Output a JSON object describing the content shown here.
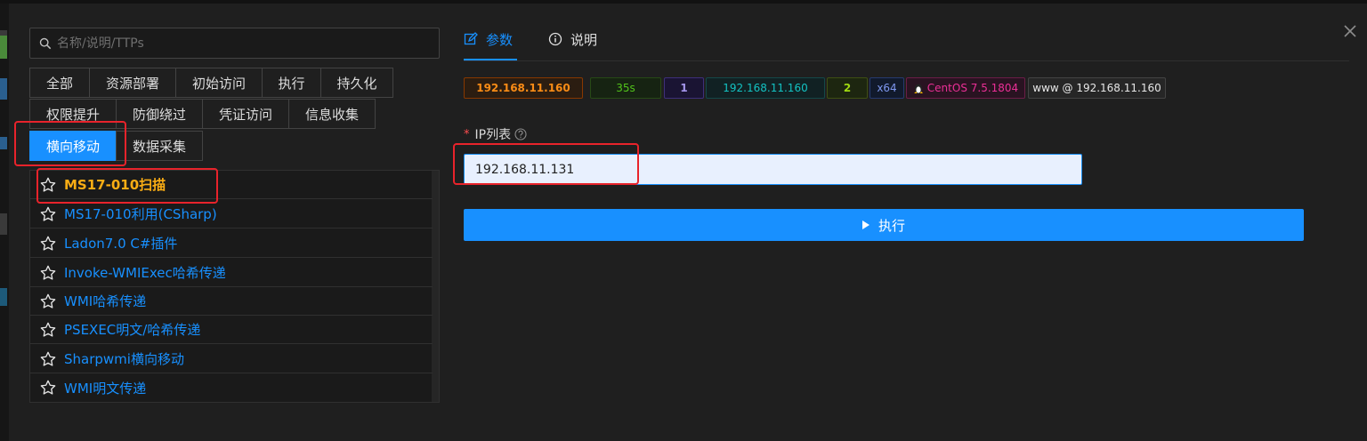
{
  "search": {
    "placeholder": "名称/说明/TTPs",
    "value": ""
  },
  "categories": [
    {
      "label": "全部"
    },
    {
      "label": "资源部署"
    },
    {
      "label": "初始访问"
    },
    {
      "label": "执行"
    },
    {
      "label": "持久化"
    },
    {
      "label": "权限提升"
    },
    {
      "label": "防御绕过"
    },
    {
      "label": "凭证访问"
    },
    {
      "label": "信息收集"
    },
    {
      "label": "横向移动",
      "active": true
    },
    {
      "label": "数据采集"
    }
  ],
  "modules": [
    {
      "label": "MS17-010扫描",
      "highlighted": true
    },
    {
      "label": "MS17-010利用(CSharp)"
    },
    {
      "label": "Ladon7.0 C#插件"
    },
    {
      "label": "Invoke-WMIExec哈希传递"
    },
    {
      "label": "WMI哈希传递"
    },
    {
      "label": "PSEXEC明文/哈希传递"
    },
    {
      "label": "Sharpwmi横向移动"
    },
    {
      "label": "WMI明文传递"
    }
  ],
  "tabs": [
    {
      "label": "参数",
      "icon": "edit-icon",
      "active": true
    },
    {
      "label": "说明",
      "icon": "info-circle-icon"
    }
  ],
  "host_tags": [
    {
      "label": "192.168.11.160",
      "color": "#fa8c16"
    },
    {
      "label": "35s",
      "color": "#52c41a"
    },
    {
      "label": "1",
      "color": "#8c7ae6"
    },
    {
      "label": "192.168.11.160",
      "color": "#13c2c2"
    },
    {
      "label": "2",
      "color": "#a0d911"
    },
    {
      "label": "x64",
      "color": "#4d6bd8"
    },
    {
      "label": "CentOS 7.5.1804",
      "color": "#eb2f96",
      "icon": "linux-icon"
    },
    {
      "label": "www @ 192.168.11.160",
      "color": "#d9d9d9"
    }
  ],
  "form": {
    "ip_label": "IP列表",
    "ip_value": "192.168.11.131",
    "run_label": "执行"
  },
  "colors": {
    "primary": "#1890ff",
    "highlight": "#faad14",
    "annotation": "#e8232b"
  }
}
